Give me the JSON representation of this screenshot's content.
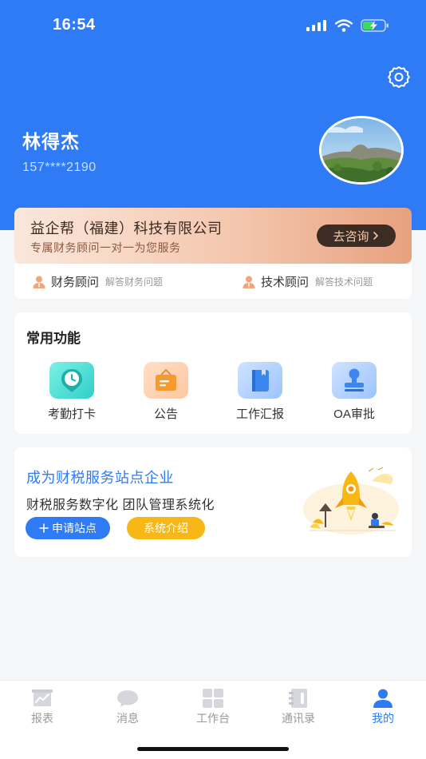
{
  "status_bar": {
    "time": "16:54"
  },
  "profile": {
    "name": "林得杰",
    "phone": "157****2190"
  },
  "company_card": {
    "name": "益企帮（福建）科技有限公司",
    "subtitle": "专属财务顾问一对一为您服务",
    "consult_label": "去咨询"
  },
  "advisors": [
    {
      "title": "财务顾问",
      "desc": "解答财务问题"
    },
    {
      "title": "技术顾问",
      "desc": "解答技术问题"
    }
  ],
  "functions": {
    "title": "常用功能",
    "items": [
      {
        "label": "考勤打卡",
        "icon": "clock-pin-icon"
      },
      {
        "label": "公告",
        "icon": "notice-board-icon"
      },
      {
        "label": "工作汇报",
        "icon": "report-book-icon"
      },
      {
        "label": "OA审批",
        "icon": "stamp-icon"
      }
    ]
  },
  "promo": {
    "title": "成为财税服务站点企业",
    "subtitle": "财税服务数字化 团队管理系统化",
    "apply_label": "申请站点",
    "intro_label": "系统介绍"
  },
  "tabs": [
    {
      "label": "报表",
      "icon": "chart-icon",
      "active": false
    },
    {
      "label": "消息",
      "icon": "message-icon",
      "active": false
    },
    {
      "label": "工作台",
      "icon": "grid-icon",
      "active": false
    },
    {
      "label": "通讯录",
      "icon": "contacts-icon",
      "active": false
    },
    {
      "label": "我的",
      "icon": "user-icon",
      "active": true
    }
  ],
  "colors": {
    "primary": "#2f7bf5",
    "accent_yellow": "#f7b715",
    "consult_bg": "#3d2c24"
  }
}
